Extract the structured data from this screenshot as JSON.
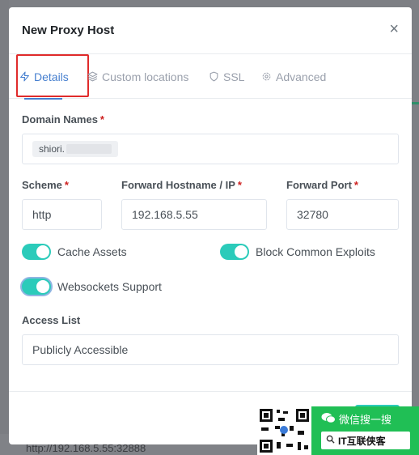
{
  "modal": {
    "title": "New Proxy Host",
    "close_glyph": "×"
  },
  "tabs": [
    {
      "label": "Details",
      "icon": "zap-icon",
      "active": true
    },
    {
      "label": "Custom locations",
      "icon": "layers-icon",
      "active": false
    },
    {
      "label": "SSL",
      "icon": "shield-icon",
      "active": false
    },
    {
      "label": "Advanced",
      "icon": "gear-icon",
      "active": false
    }
  ],
  "form": {
    "domain_names_label": "Domain Names",
    "domain_tag": "shiori.",
    "scheme_label": "Scheme",
    "scheme_value": "http",
    "hostname_label": "Forward Hostname / IP",
    "hostname_value": "192.168.5.55",
    "port_label": "Forward Port",
    "port_value": "32780",
    "required_mark": "*",
    "cache_assets_label": "Cache Assets",
    "block_exploits_label": "Block Common Exploits",
    "websockets_label": "Websockets Support",
    "access_list_label": "Access List",
    "access_list_value": "Publicly Accessible"
  },
  "toggles": {
    "cache_assets": true,
    "block_exploits": true,
    "websockets": true
  },
  "background": {
    "url_text": "http://192.168.5.55:32888"
  },
  "watermark": {
    "search_text": "微信搜一搜",
    "account_text": "IT互联侠客"
  },
  "colors": {
    "accent": "#467fcf",
    "toggle_on": "#2bcbba",
    "required": "#cd201f",
    "highlight": "#e02b2b",
    "wechat_green": "#20bf55"
  }
}
